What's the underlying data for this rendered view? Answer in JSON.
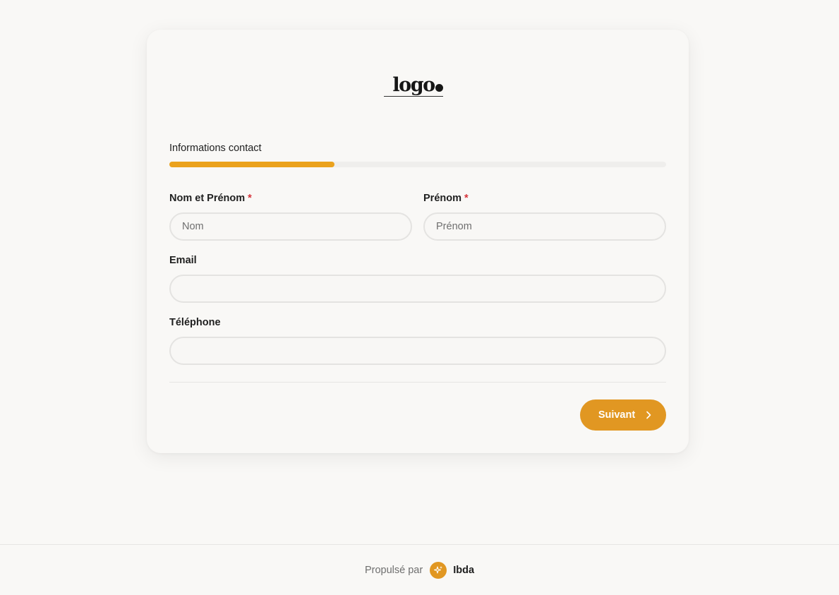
{
  "brand": {
    "logo_text": "logo",
    "accent_color": "#e19722",
    "progress_color": "#eba21d"
  },
  "form": {
    "step_title": "Informations contact",
    "progress": 0.333,
    "fields": {
      "nom": {
        "label": "Nom et Prénom",
        "required_mark": "*",
        "placeholder": "Nom",
        "value": ""
      },
      "prenom": {
        "label": "Prénom",
        "required_mark": "*",
        "placeholder": "Prénom",
        "value": ""
      },
      "email": {
        "label": "Email",
        "placeholder": "",
        "value": ""
      },
      "telephone": {
        "label": "Téléphone",
        "placeholder": "",
        "value": ""
      }
    },
    "next_label": "Suivant",
    "next_icon": "chevron-right-icon"
  },
  "footer": {
    "powered_by": "Propulsé par",
    "brand_icon": "sparkle-icon",
    "brand_name": "Ibda"
  }
}
